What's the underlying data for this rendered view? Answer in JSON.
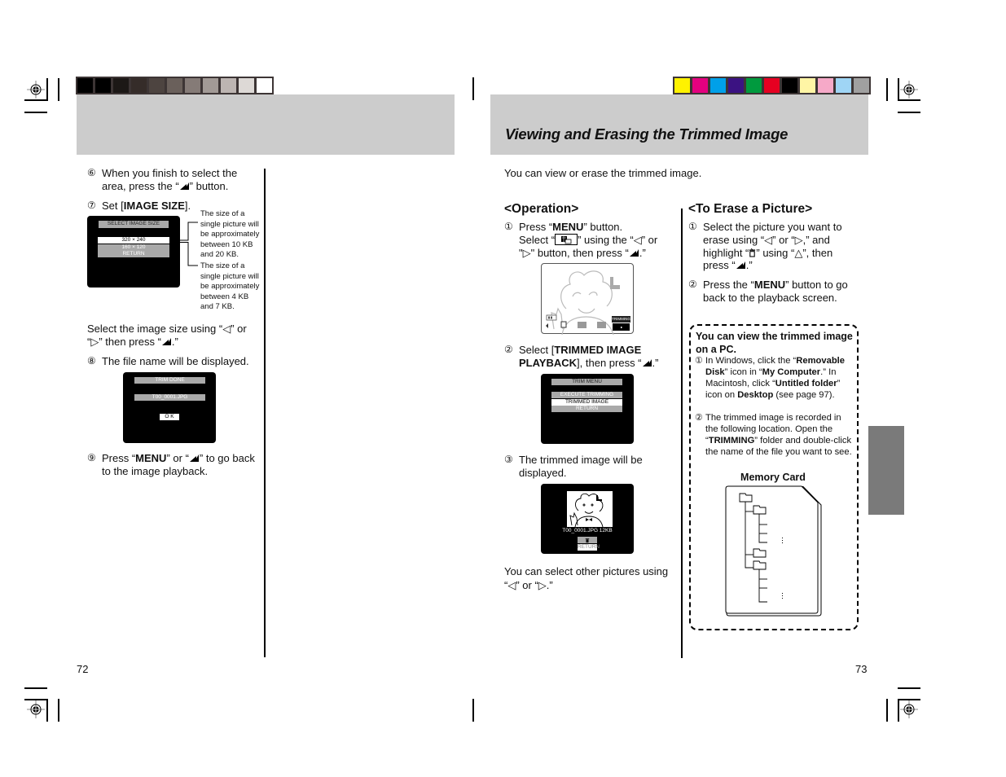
{
  "color_bars": {
    "left_grayscale": [
      "#000000",
      "#000000",
      "#1c1816",
      "#352c29",
      "#4d4440",
      "#6a605b",
      "#857b77",
      "#a29a96",
      "#bdb5b2",
      "#ddd9d6",
      "#ffffff"
    ],
    "right_color": [
      "#fff200",
      "#e4007f",
      "#00a0e9",
      "#3b1282",
      "#009a3e",
      "#e60021",
      "#000000",
      "#fff5a5",
      "#f6a9c8",
      "#9fd5f5",
      "#a0a0a0"
    ]
  },
  "left_page": {
    "page_number": "72",
    "step6": {
      "num": "⑥",
      "text_a": "When you finish to select the area, press the “",
      "text_b": "” button."
    },
    "step7": {
      "num": "⑦",
      "text_a": "Set [",
      "bold": "IMAGE SIZE",
      "text_b": "]."
    },
    "screen_image_size": {
      "title": "SELECT IMAGE SIZE",
      "options": [
        "320  ×  240",
        "160  ×  120",
        "RETURN"
      ],
      "selected_index": 0
    },
    "note_320": "The size of a single picture will be approximately between 10 KB and 20 KB.",
    "note_160": "The size of a single picture will be approximately between 4 KB and 7 KB.",
    "select_size_text_a": "Select the image size using “◁” or “▷” then press “",
    "select_size_text_b": ".”",
    "step8": {
      "num": "⑧",
      "text": "The file name will be displayed."
    },
    "screen_trim_done": {
      "title": "TRIM DONE",
      "filename": "T00_0001.JPG",
      "ok": "O K"
    },
    "step9": {
      "num": "⑨",
      "text_a": "Press “",
      "bold": "MENU",
      "text_b": "” or “",
      "text_c": "” to go back to the image playback."
    }
  },
  "right_page": {
    "page_number": "73",
    "title": "Viewing and Erasing the Trimmed Image",
    "intro": "You can view or erase the trimmed image.",
    "operation": {
      "heading": "<Operation>",
      "step1": {
        "num": "①",
        "text_a": "Press “",
        "bold": "MENU",
        "text_b": "” button.",
        "text_c": "Select “",
        "text_d": "” using the “◁” or \"▷\" button, then press “",
        "text_e": ".”"
      },
      "screen_playback": {
        "badge": "TRIMMING"
      },
      "step2": {
        "num": "②",
        "text_a": "Select [",
        "bold": "TRIMMED IMAGE PLAYBACK",
        "text_b": "], then press “",
        "text_c": ".”"
      },
      "screen_trim_menu": {
        "title": "TRIM MENU",
        "options": [
          "EXECUTE TRIMMING",
          "TRIMMED IMAGE PLAYBACK",
          "RETURN"
        ],
        "selected_index": 1
      },
      "step3": {
        "num": "③",
        "text": "The trimmed image will be displayed."
      },
      "screen_trimmed": {
        "caption": "T00_0001.JPG   12KB",
        "return": "RETURN"
      },
      "footer": "You can select other pictures using “◁” or “▷.”"
    },
    "erase": {
      "heading": "<To Erase a Picture>",
      "step1": {
        "num": "①",
        "text_a": "Select the picture you want to erase using “◁” or “▷,” and highlight “",
        "text_b": "” using “△”, then press “",
        "text_c": ".”"
      },
      "step2": {
        "num": "②",
        "text_a": "Press the “",
        "bold": "MENU",
        "text_b": "” button to go back to the playback screen."
      }
    },
    "pc_tip": {
      "heading": "You can view the trimmed image on a PC.",
      "step1": {
        "num": "①",
        "t1": "In Windows, click the “",
        "b1": "Removable Disk",
        "t2": "” icon in “",
        "b2": "My Computer",
        "t3": ".” In Macintosh, click “",
        "b3": "Untitled folder",
        "t4": "” icon on ",
        "b4": "Desktop",
        "t5": " (see page 97)."
      },
      "step2": {
        "num": "②",
        "t1": "The trimmed image is recorded in the following location. Open the “",
        "b1": "TRIMMING",
        "t2": "” folder and double-click the name of the file you want to see."
      },
      "memory_card_label": "Memory Card"
    }
  }
}
